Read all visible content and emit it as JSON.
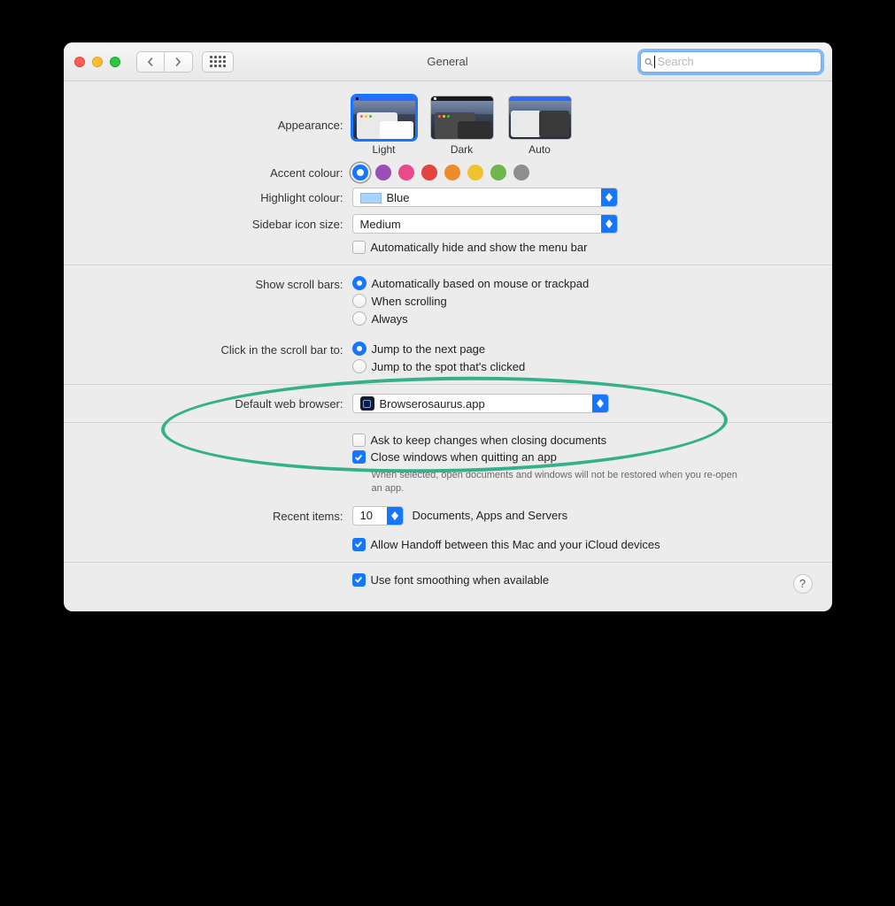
{
  "window": {
    "title": "General"
  },
  "search": {
    "placeholder": "Search"
  },
  "appearance": {
    "label": "Appearance:",
    "options": [
      "Light",
      "Dark",
      "Auto"
    ],
    "selected": "Light"
  },
  "accent": {
    "label": "Accent colour:",
    "colors": [
      "#1676ff",
      "#9c4eb8",
      "#e94b8a",
      "#e2453f",
      "#ee8b2c",
      "#f0c22e",
      "#6fb74d",
      "#8e8e8e"
    ],
    "selected_index": 0
  },
  "highlight": {
    "label": "Highlight colour:",
    "value": "Blue"
  },
  "sidebar_size": {
    "label": "Sidebar icon size:",
    "value": "Medium"
  },
  "auto_hide_menu": {
    "label": "Automatically hide and show the menu bar",
    "checked": false
  },
  "scroll_bars": {
    "label": "Show scroll bars:",
    "options": [
      "Automatically based on mouse or trackpad",
      "When scrolling",
      "Always"
    ],
    "selected_index": 0
  },
  "click_scroll": {
    "label": "Click in the scroll bar to:",
    "options": [
      "Jump to the next page",
      "Jump to the spot that's clicked"
    ],
    "selected_index": 0
  },
  "browser": {
    "label": "Default web browser:",
    "value": "Browserosaurus.app"
  },
  "ask_keep": {
    "label": "Ask to keep changes when closing documents",
    "checked": false
  },
  "close_windows": {
    "label": "Close windows when quitting an app",
    "checked": true,
    "note": "When selected, open documents and windows will not be restored when you re-open an app."
  },
  "recent": {
    "label": "Recent items:",
    "value": "10",
    "suffix": "Documents, Apps and Servers"
  },
  "handoff": {
    "label": "Allow Handoff between this Mac and your iCloud devices",
    "checked": true
  },
  "font_smoothing": {
    "label": "Use font smoothing when available",
    "checked": true
  },
  "help": "?"
}
